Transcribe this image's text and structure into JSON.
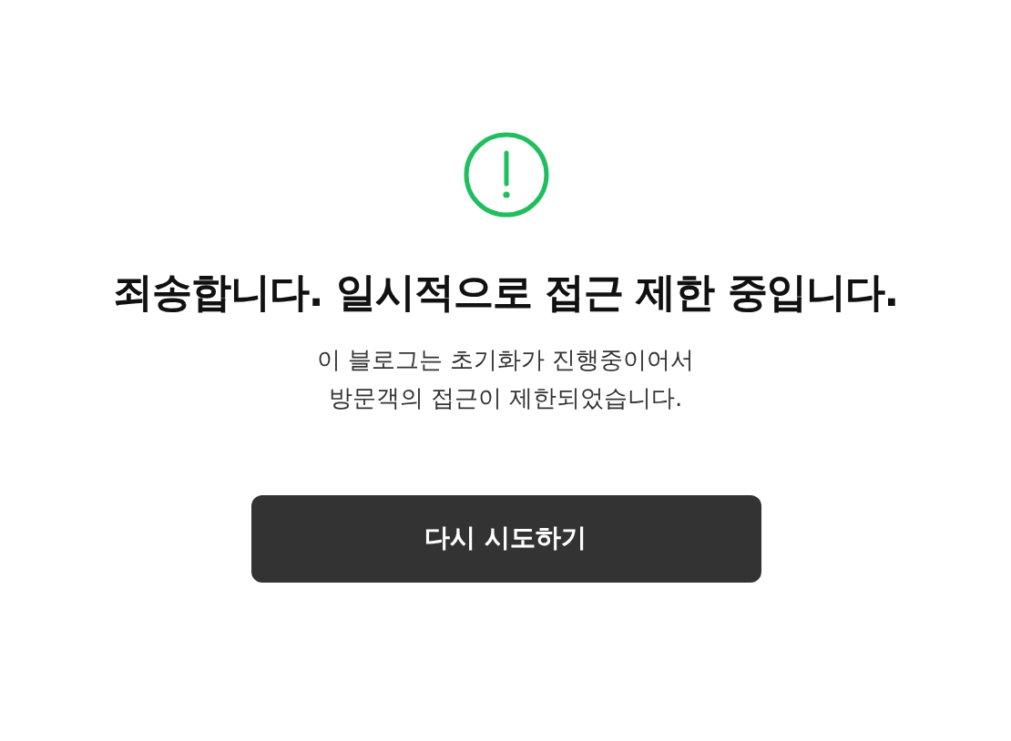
{
  "notice": {
    "title": "죄송합니다. 일시적으로 접근 제한 중입니다.",
    "message_lines": [
      "이 블로그는 초기화가 진행중이어서",
      "방문객의 접근이 제한되었습니다."
    ]
  },
  "button": {
    "label": "다시 시도하기"
  }
}
